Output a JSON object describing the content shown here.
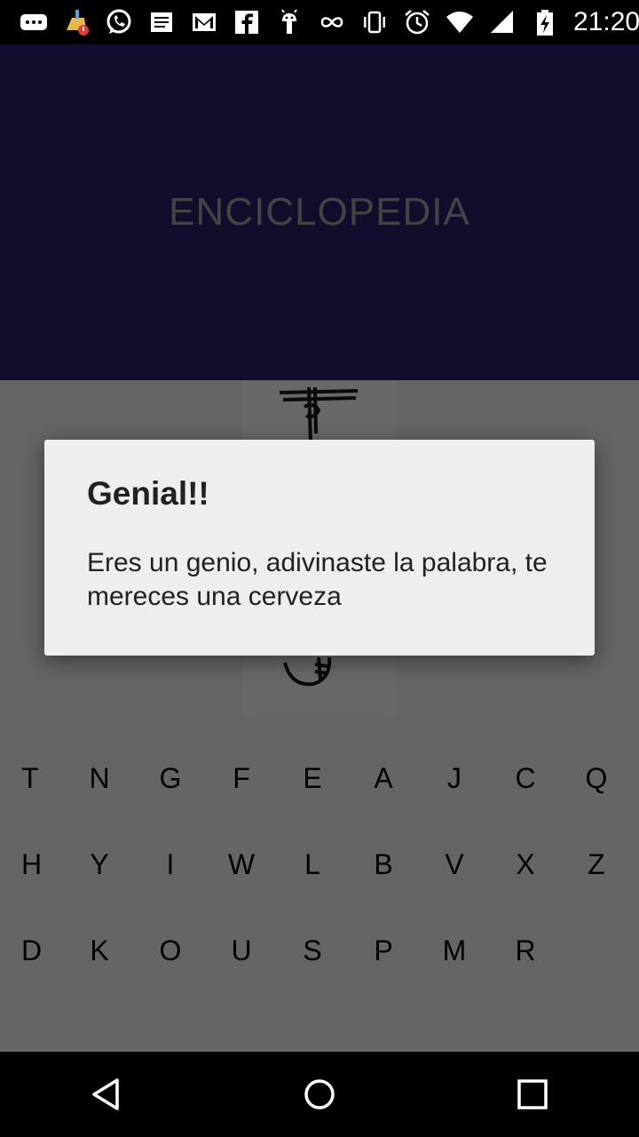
{
  "status_bar": {
    "time": "21:20",
    "left_icons": [
      "message-icon",
      "cleaner-icon",
      "whatsapp-icon",
      "document-icon",
      "gmail-icon",
      "facebook-icon",
      "android-icon",
      "infinity-icon"
    ],
    "right_icons": [
      "vibrate-icon",
      "alarm-icon",
      "wifi-icon",
      "signal-icon",
      "battery-charging-icon"
    ]
  },
  "header": {
    "title": "ENCICLOPEDIA"
  },
  "keyboard": {
    "rows": [
      [
        "T",
        "N",
        "G",
        "F",
        "E",
        "A",
        "J",
        "C",
        "Q"
      ],
      [
        "H",
        "Y",
        "I",
        "W",
        "L",
        "B",
        "V",
        "X",
        "Z"
      ],
      [
        "D",
        "K",
        "O",
        "U",
        "S",
        "P",
        "M",
        "R"
      ]
    ]
  },
  "dialog": {
    "title": "Genial!!",
    "message": "Eres un genio, adivinaste la palabra, te mereces una cerveza"
  },
  "nav_bar": {
    "icons": [
      "back-icon",
      "home-icon",
      "recents-icon"
    ]
  },
  "colors": {
    "header_bg": "#211447",
    "dialog_bg": "#eeeeee",
    "status_bar": "#000000"
  }
}
